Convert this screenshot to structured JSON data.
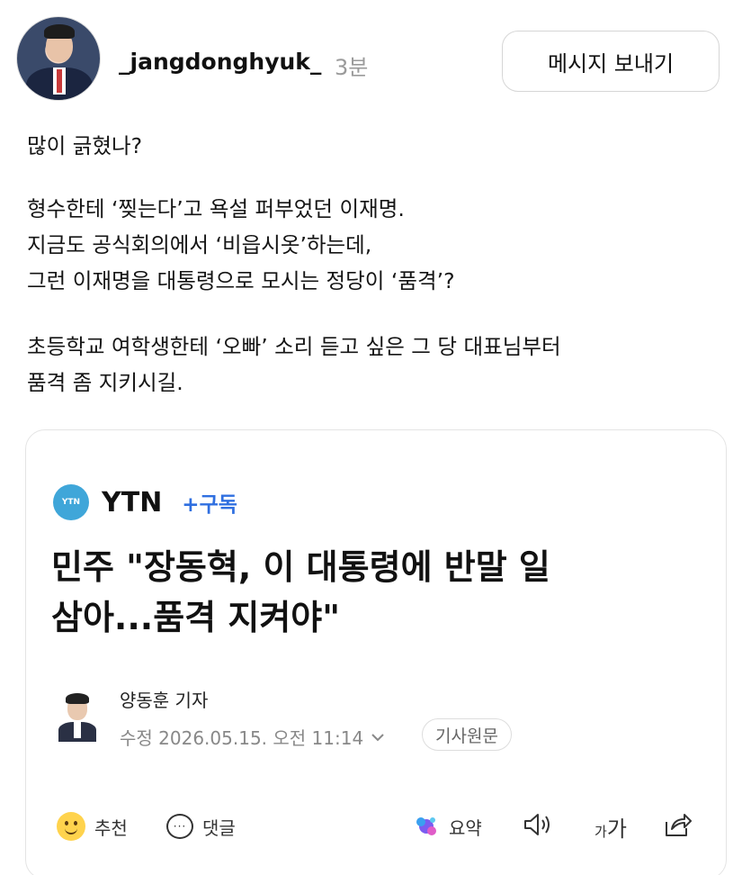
{
  "post": {
    "username": "_jangdonghyuk_",
    "time": "3분",
    "message_button": "메시지 보내기",
    "paragraph1": "많이 긁혔나?",
    "paragraph2": [
      "형수한테 ‘찢는다’고 욕설 퍼부었던 이재명.",
      "지금도 공식회의에서 ‘비읍시옷’하는데,",
      "그런 이재명을 대통령으로 모시는 정당이 ‘품격’?"
    ],
    "paragraph3": [
      "초등학교 여학생한테 ‘오빠’ 소리 듣고 싶은 그 당 대표님부터",
      "품격 좀 지키시길."
    ]
  },
  "article": {
    "source_logo_text": "YTN",
    "source_name": "YTN",
    "subscribe_label": "+구독",
    "headline_lines": [
      "민주 \"장동혁, 이 대통령에 반말 일",
      "삼아...품격 지켜야\""
    ],
    "reporter": "양동훈 기자",
    "modified": "수정 2026.05.15. 오전 11:14",
    "original_button": "기사원문",
    "actions": {
      "recommend": "추천",
      "comment": "댓글",
      "summary": "요약",
      "font_small": "가",
      "font_large": "가"
    }
  },
  "colors": {
    "accent_blue": "#2f6fe0",
    "ytn_logo": "#3fa6d9",
    "muted_text": "#9a9a9a"
  },
  "icons": [
    "user-avatar",
    "ytn-logo-icon",
    "reporter-avatar",
    "chevron-down-icon",
    "smile-emoji-icon",
    "comment-bubble-icon",
    "sparkle-summary-icon",
    "speaker-icon",
    "font-size-icon",
    "share-icon"
  ]
}
